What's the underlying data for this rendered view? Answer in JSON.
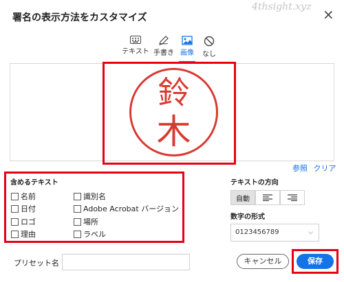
{
  "dialog": {
    "title": "署名の表示方法をカスタマイズ",
    "watermark": "4thsight.xyz"
  },
  "tabs": [
    {
      "label": "テキスト",
      "icon": "keyboard-icon",
      "active": false
    },
    {
      "label": "手書き",
      "icon": "pen-icon",
      "active": false
    },
    {
      "label": "画像",
      "icon": "image-icon",
      "active": true
    },
    {
      "label": "なし",
      "icon": "none-icon",
      "active": false
    }
  ],
  "stamp": {
    "char1": "鈴",
    "char2": "木",
    "color": "#d83a32"
  },
  "preview_links": {
    "browse": "参照",
    "clear": "クリア"
  },
  "include_text": {
    "heading": "含めるテキスト",
    "options": [
      {
        "label": "名前",
        "checked": false
      },
      {
        "label": "識別名",
        "checked": false
      },
      {
        "label": "日付",
        "checked": false
      },
      {
        "label": "Adobe Acrobat バージョン",
        "checked": false
      },
      {
        "label": "ロゴ",
        "checked": false
      },
      {
        "label": "場所",
        "checked": false
      },
      {
        "label": "理由",
        "checked": false
      },
      {
        "label": "ラベル",
        "checked": false
      }
    ]
  },
  "text_direction": {
    "heading": "テキストの方向",
    "auto_label": "自動",
    "selected": "自動"
  },
  "number_format": {
    "heading": "数字の形式",
    "value": "0123456789"
  },
  "preset": {
    "label": "プリセット名",
    "value": ""
  },
  "buttons": {
    "cancel": "キャンセル",
    "save": "保存"
  },
  "colors": {
    "accent": "#1473e6",
    "highlight_box": "#e60012"
  }
}
